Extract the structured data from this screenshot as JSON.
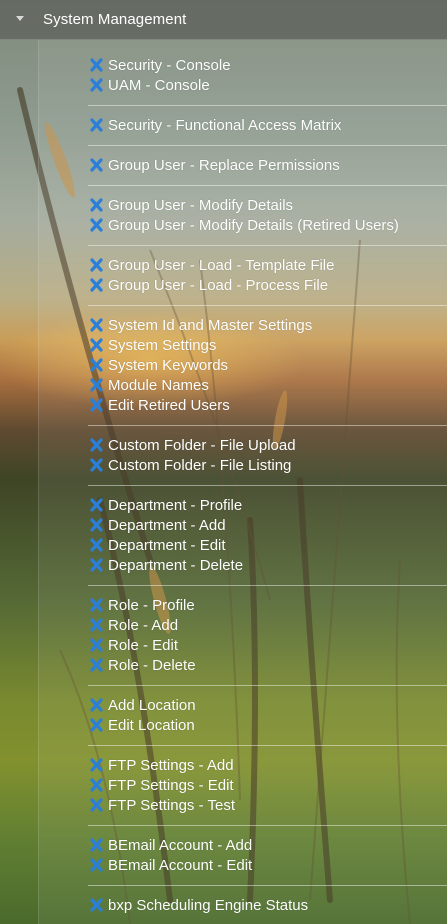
{
  "header": {
    "title": "System Management",
    "expand_icon": "caret-down-icon"
  },
  "item_icon": "remove-x-icon",
  "colors": {
    "icon": "#2a7fd8",
    "text": "#ffffff",
    "header_bg": "#5c605a"
  },
  "groups": [
    {
      "items": [
        "Security - Console",
        "UAM - Console"
      ]
    },
    {
      "items": [
        "Security - Functional Access Matrix"
      ]
    },
    {
      "items": [
        "Group User - Replace Permissions"
      ]
    },
    {
      "items": [
        "Group User - Modify Details",
        "Group User - Modify Details (Retired Users)"
      ]
    },
    {
      "items": [
        "Group User - Load - Template File",
        "Group User - Load - Process File"
      ]
    },
    {
      "items": [
        "System Id and Master Settings",
        "System Settings",
        "System Keywords",
        "Module Names",
        "Edit Retired Users"
      ]
    },
    {
      "items": [
        "Custom Folder - File Upload",
        "Custom Folder - File Listing"
      ]
    },
    {
      "items": [
        "Department - Profile",
        "Department - Add",
        "Department - Edit",
        "Department - Delete"
      ]
    },
    {
      "items": [
        "Role - Profile",
        "Role - Add",
        "Role - Edit",
        "Role - Delete"
      ]
    },
    {
      "items": [
        "Add Location",
        "Edit Location"
      ]
    },
    {
      "items": [
        "FTP Settings - Add",
        "FTP Settings - Edit",
        "FTP Settings - Test"
      ]
    },
    {
      "items": [
        "BEmail Account - Add",
        "BEmail Account - Edit"
      ]
    },
    {
      "items": [
        "bxp Scheduling Engine Status"
      ]
    }
  ]
}
